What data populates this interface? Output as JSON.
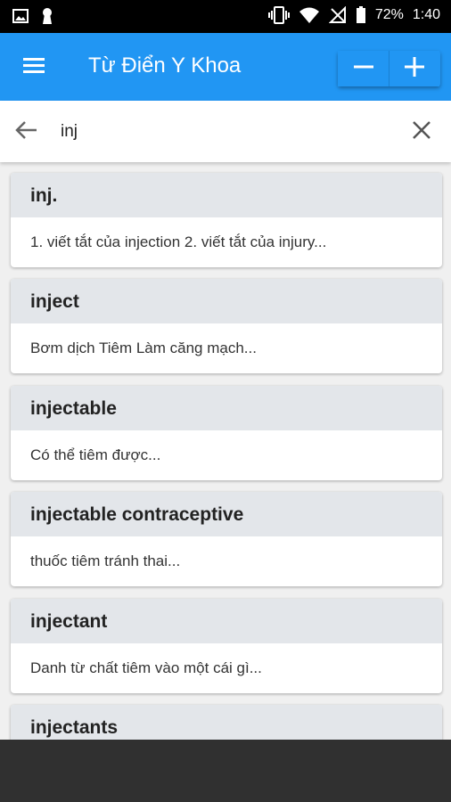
{
  "status_bar": {
    "battery_percent": "72%",
    "time": "1:40",
    "left_icons": [
      "image-icon",
      "keyhole-icon"
    ],
    "right_icons": [
      "vibrate-icon",
      "wifi-icon",
      "no-sim-icon",
      "battery-icon"
    ]
  },
  "app_bar": {
    "title": "Từ Điển Y Khoa",
    "menu_icon": "hamburger-menu-icon",
    "zoom_out_icon": "minus-icon",
    "zoom_in_icon": "plus-icon",
    "color": "#2196f3"
  },
  "search": {
    "back_icon": "arrow-left-icon",
    "value": "inj",
    "clear_icon": "close-icon"
  },
  "results": [
    {
      "term": "inj.",
      "definition": "1. viết tắt của injection 2. viết tắt của injury..."
    },
    {
      "term": "inject",
      "definition": "Bơm dịch Tiêm Làm căng mạch..."
    },
    {
      "term": "injectable",
      "definition": "Có thể tiêm được..."
    },
    {
      "term": "injectable contraceptive",
      "definition": "thuốc tiêm tránh thai..."
    },
    {
      "term": "injectant",
      "definition": "Danh từ chất tiêm vào một cái gì..."
    },
    {
      "term": "injectants",
      "definition": ""
    }
  ]
}
